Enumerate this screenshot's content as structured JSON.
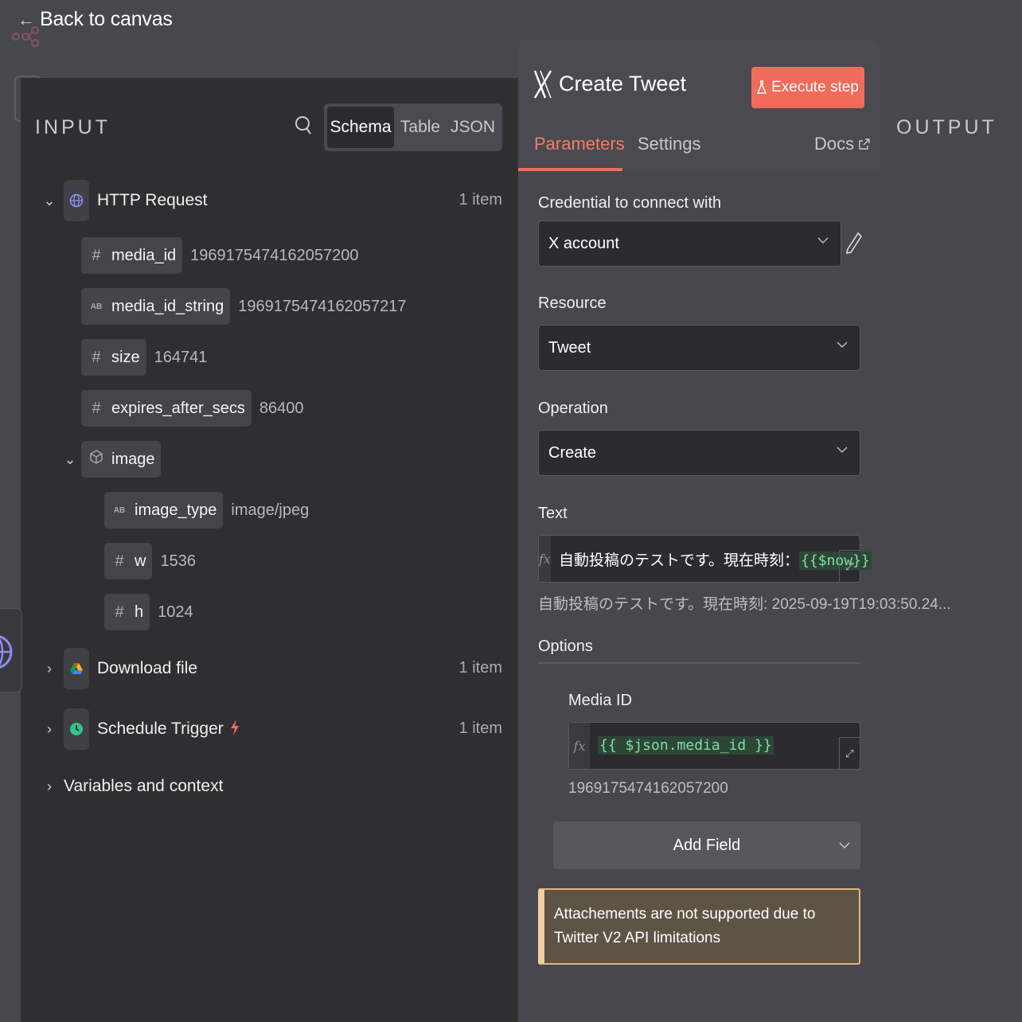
{
  "header": {
    "back_label": "Back to canvas"
  },
  "input": {
    "title": "INPUT",
    "view_tabs": [
      "Schema",
      "Table",
      "JSON"
    ],
    "active_view": "Schema",
    "nodes": {
      "http": {
        "name": "HTTP Request",
        "count": "1 item"
      },
      "download": {
        "name": "Download file",
        "count": "1 item"
      },
      "schedule": {
        "name": "Schedule Trigger",
        "count": "1 item"
      },
      "variables": {
        "name": "Variables and context"
      }
    },
    "fields": {
      "media_id": {
        "type": "#",
        "key": "media_id",
        "value": "1969175474162057200"
      },
      "media_id_string": {
        "type": "AB",
        "key": "media_id_string",
        "value": "1969175474162057217"
      },
      "size": {
        "type": "#",
        "key": "size",
        "value": "164741"
      },
      "expires": {
        "type": "#",
        "key": "expires_after_secs",
        "value": "86400"
      },
      "image": {
        "key": "image"
      },
      "image_type": {
        "type": "AB",
        "key": "image_type",
        "value": "image/jpeg"
      },
      "w": {
        "type": "#",
        "key": "w",
        "value": "1536"
      },
      "h": {
        "type": "#",
        "key": "h",
        "value": "1024"
      }
    }
  },
  "output": {
    "title": "OUTPUT"
  },
  "node_panel": {
    "title": "Create Tweet",
    "execute_label": "Execute step",
    "tabs": {
      "parameters": "Parameters",
      "settings": "Settings",
      "docs": "Docs"
    },
    "credential": {
      "label": "Credential to connect with",
      "value": "X account"
    },
    "resource": {
      "label": "Resource",
      "value": "Tweet"
    },
    "operation": {
      "label": "Operation",
      "value": "Create"
    },
    "text": {
      "label": "Text",
      "prefix": "自動投稿のテストです。現在時刻：",
      "expression": "{{$now}}",
      "preview": "自動投稿のテストです。現在時刻: 2025-09-19T19:03:50.24..."
    },
    "options": {
      "label": "Options",
      "media_id": {
        "label": "Media ID",
        "expression": "{{ $json.media_id }}",
        "preview": "1969175474162057200"
      },
      "add_field_label": "Add Field"
    },
    "notice": "Attachements are not supported due to Twitter V2 API limitations"
  },
  "colors": {
    "accent": "#ef6b5a",
    "panel_bg": "#2f2f32",
    "notice_border": "#e0b879"
  }
}
